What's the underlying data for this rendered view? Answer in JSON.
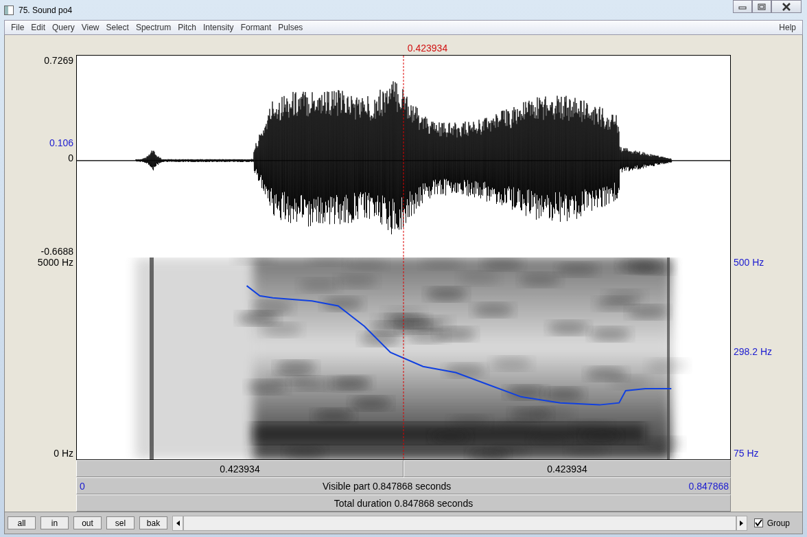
{
  "window": {
    "title": "75. Sound po4"
  },
  "menu": {
    "items": [
      "File",
      "Edit",
      "Query",
      "View",
      "Select",
      "Spectrum",
      "Pitch",
      "Intensity",
      "Formant",
      "Pulses"
    ],
    "help": "Help"
  },
  "cursor_time": "0.423934",
  "waveform": {
    "max": "0.7269",
    "marker": "0.106",
    "zero": "0",
    "min": "-0.6688"
  },
  "spectrogram": {
    "freq_top": "5000 Hz",
    "freq_bottom": "0 Hz",
    "pitch_top": "500 Hz",
    "pitch_mid": "298.2 Hz",
    "pitch_bottom": "75 Hz"
  },
  "time_bars": {
    "left_part": "0.423934",
    "right_part": "0.423934",
    "visible_start": "0",
    "visible_label": "Visible part 0.847868 seconds",
    "visible_end": "0.847868",
    "total_label": "Total duration 0.847868 seconds"
  },
  "buttons": [
    "all",
    "in",
    "out",
    "sel",
    "bak"
  ],
  "group": {
    "label": "Group",
    "checked": true
  }
}
